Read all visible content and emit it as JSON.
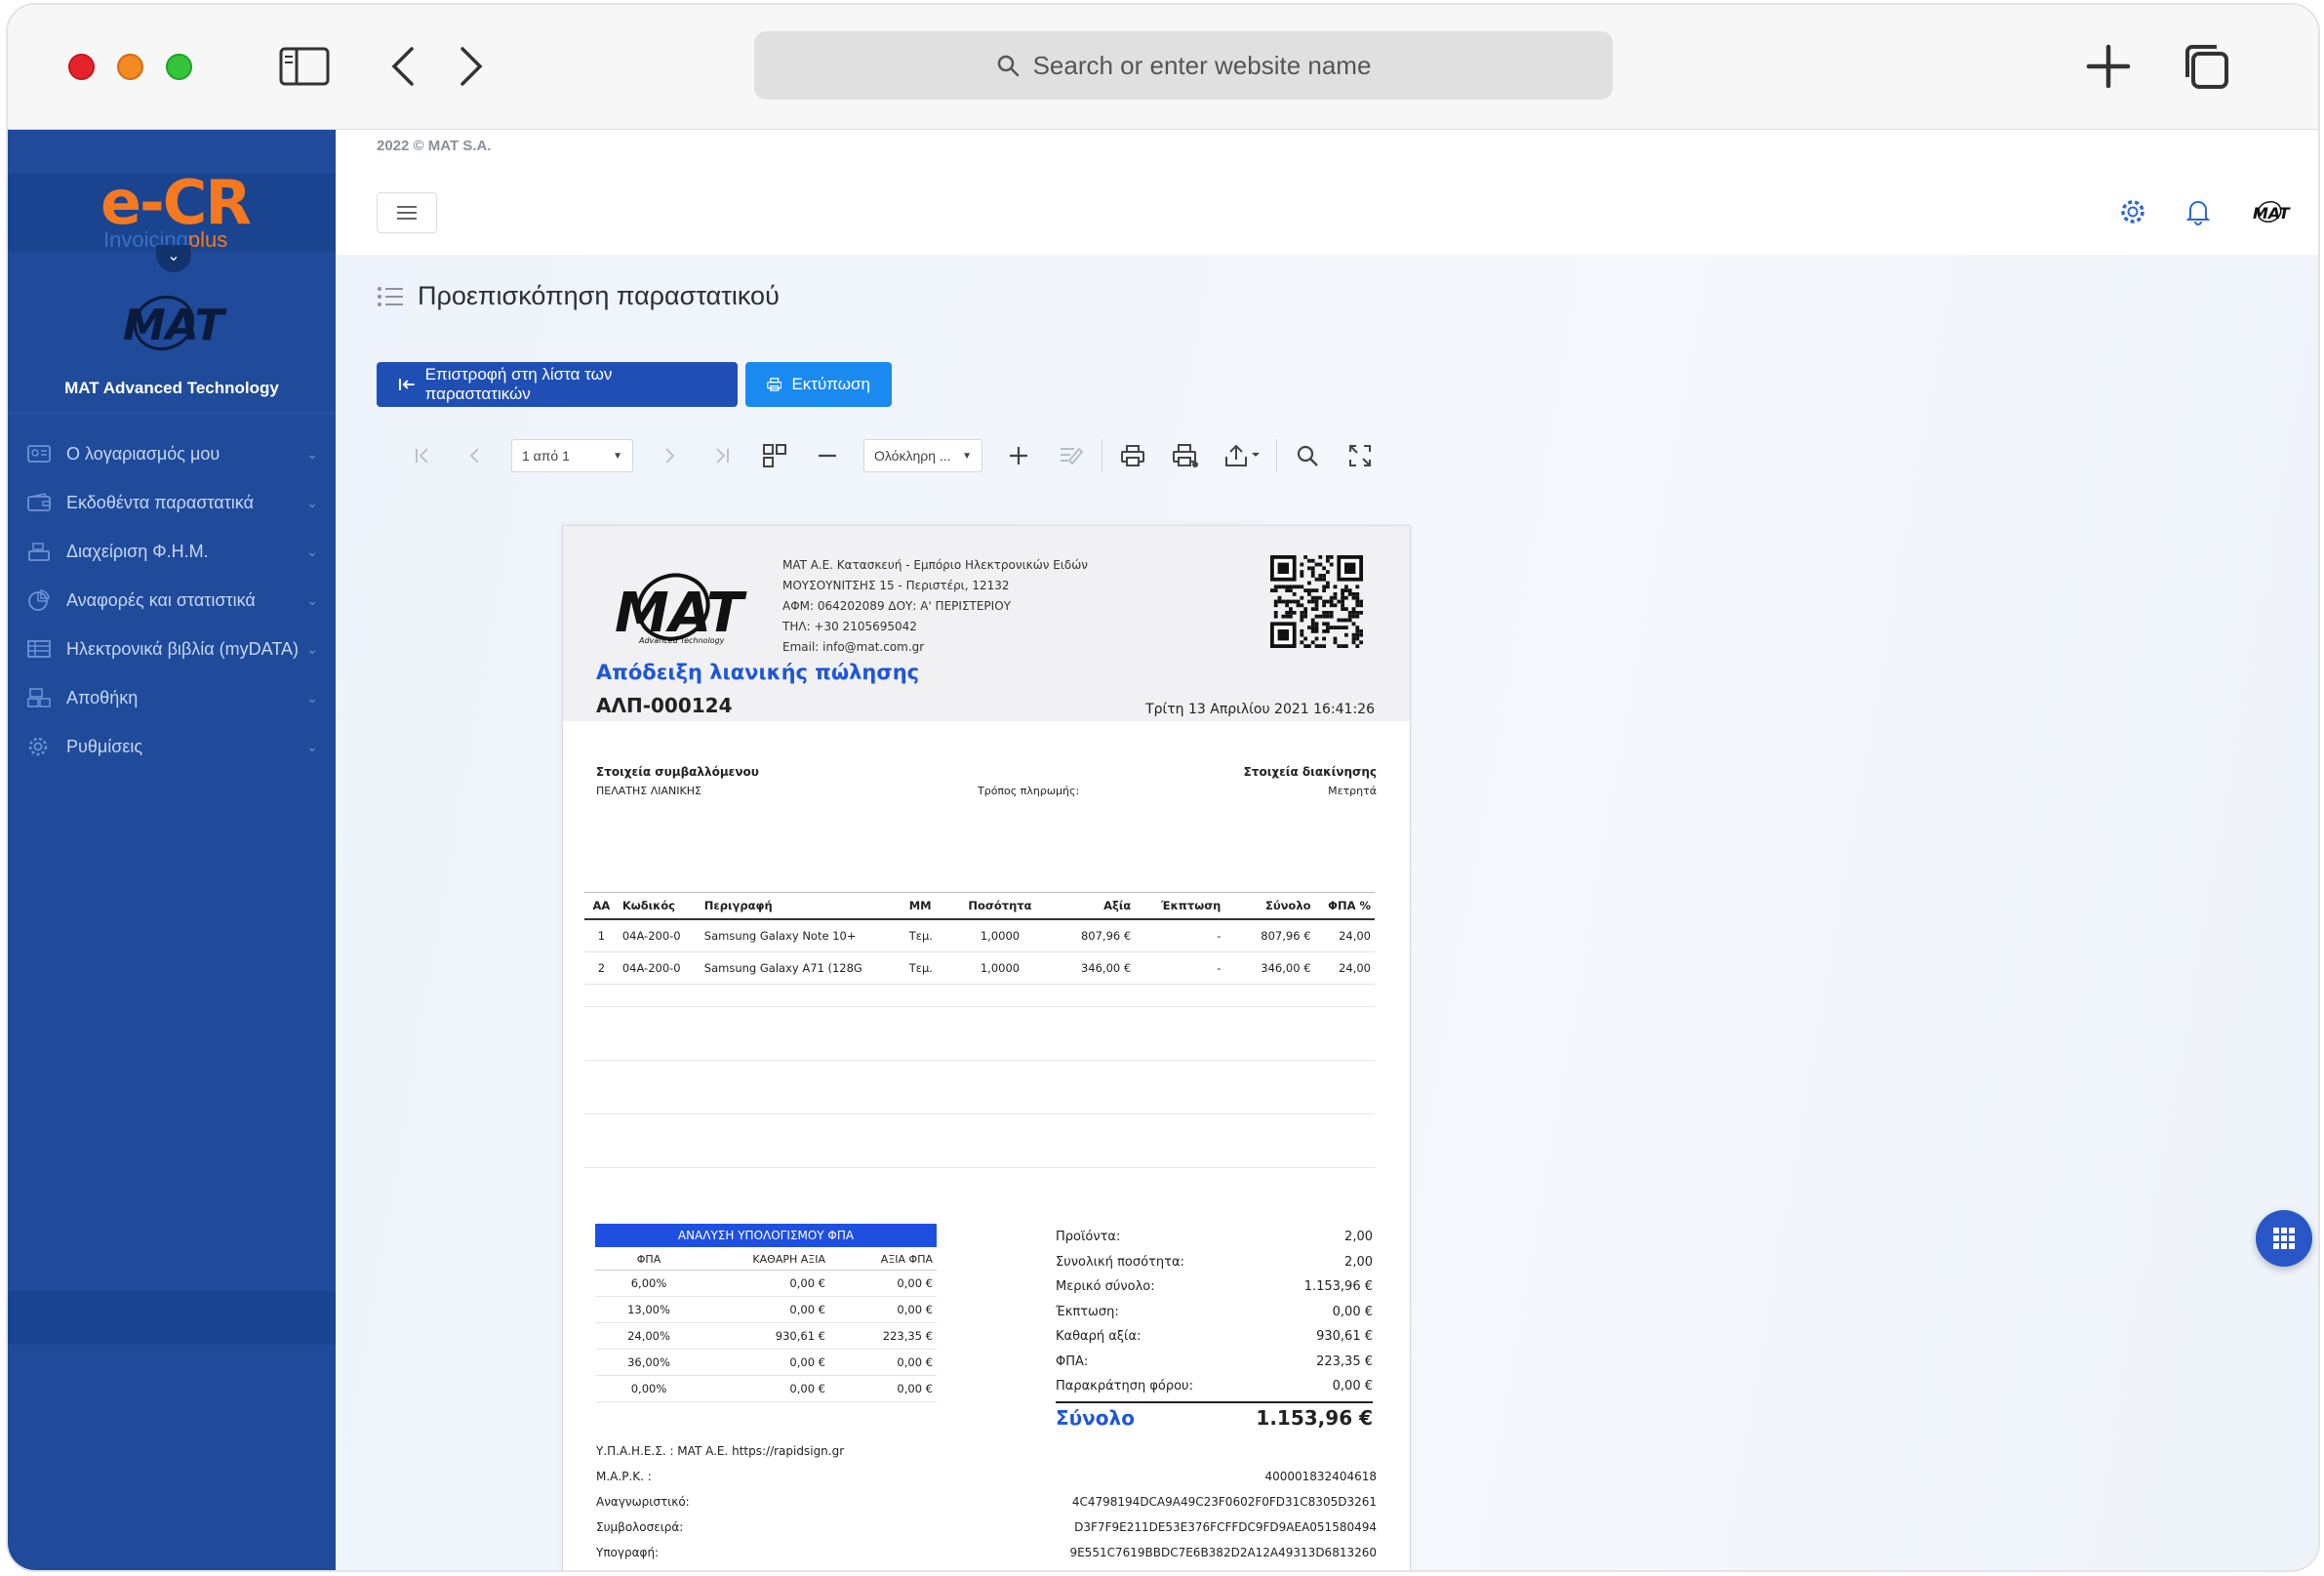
{
  "browser": {
    "url_placeholder": "Search or enter website name"
  },
  "sidebar": {
    "brand_main": "e-CR",
    "brand_sub_a": "Invoicing",
    "brand_sub_b": "plus",
    "org_name": "MAT Advanced Technology",
    "items": [
      {
        "label": "Ο λογαριασμός μου",
        "icon": "user-card-icon"
      },
      {
        "label": "Εκδοθέντα παραστατικά",
        "icon": "wallet-icon"
      },
      {
        "label": "Διαχείριση Φ.Η.Μ.",
        "icon": "cash-register-icon"
      },
      {
        "label": "Αναφορές και στατιστικά",
        "icon": "pie-chart-icon"
      },
      {
        "label": "Ηλεκτρονικά βιβλία (myDATA)",
        "icon": "table-icon"
      },
      {
        "label": "Αποθήκη",
        "icon": "warehouse-icon"
      },
      {
        "label": "Ρυθμίσεις",
        "icon": "gear-icon"
      }
    ]
  },
  "header": {
    "copyright": "2022 © MAT S.A.",
    "page_title": "Προεπισκόπηση παραστατικού",
    "back_button": "Επιστροφή στη λίστα των παραστατικών",
    "print_button": "Εκτύπωση"
  },
  "viewer": {
    "page_indicator": "1 από 1",
    "zoom_mode": "Ολόκληρη ..."
  },
  "document": {
    "logo_text": "MAT",
    "logo_tagline": "Advanced Technology",
    "issuer_lines": [
      "MAT A.E. Κατασκευή - Εμπόριο Ηλεκτρονικών Ειδών",
      "ΜΟΥΣΟΥΝΙΤΣΗΣ 15 - Περιστέρι, 12132",
      "ΑΦΜ: 064202089 ΔΟΥ: Α' ΠΕΡΙΣΤΕΡΙΟΥ",
      "ΤΗΛ: +30 2105695042",
      "Email: info@mat.com.gr"
    ],
    "title": "Απόδειξη λιανικής πώλησης",
    "number": "ΑΛΠ-000124",
    "date": "Τρίτη 13 Απριλίου 2021 16:41:26",
    "counterparty_label": "Στοιχεία συμβαλλόμενου",
    "counterparty_value": "ΠΕΛΑΤΗΣ ΛΙΑΝΙΚΗΣ",
    "payment_label": "Τρόπος πληρωμής:",
    "shipping_label": "Στοιχεία διακίνησης",
    "shipping_value": "Μετρητά",
    "columns": [
      "ΑΑ",
      "Κωδικός",
      "Περιγραφή",
      "ΜΜ",
      "Ποσότητα",
      "Αξία",
      "Έκπτωση",
      "Σύνολο",
      "ΦΠΑ %"
    ],
    "items": [
      {
        "aa": "1",
        "code": "04A-200-0",
        "desc": "Samsung Galaxy Note 10+",
        "unit": "Τεμ.",
        "qty": "1,0000",
        "value": "807,96 €",
        "discount": "-",
        "total": "807,96 €",
        "vat": "24,00"
      },
      {
        "aa": "2",
        "code": "04A-200-0",
        "desc": "Samsung Galaxy A71 (128G",
        "unit": "Τεμ.",
        "qty": "1,0000",
        "value": "346,00 €",
        "discount": "-",
        "total": "346,00 €",
        "vat": "24,00"
      }
    ],
    "vat_analysis_title": "ΑΝΑΛΥΣΗ ΥΠΟΛΟΓΙΣΜΟΥ ΦΠΑ",
    "vat_columns": [
      "ΦΠΑ",
      "ΚΑΘΑΡΗ ΑΞΙΑ",
      "ΑΞΙΑ ΦΠΑ"
    ],
    "vat_rows": [
      {
        "rate": "6,00%",
        "net": "0,00 €",
        "vat": "0,00 €"
      },
      {
        "rate": "13,00%",
        "net": "0,00 €",
        "vat": "0,00 €"
      },
      {
        "rate": "24,00%",
        "net": "930,61 €",
        "vat": "223,35 €"
      },
      {
        "rate": "36,00%",
        "net": "0,00 €",
        "vat": "0,00 €"
      },
      {
        "rate": "0,00%",
        "net": "0,00 €",
        "vat": "0,00 €"
      }
    ],
    "totals": [
      {
        "label": "Προϊόντα:",
        "value": "2,00"
      },
      {
        "label": "Συνολική ποσότητα:",
        "value": "2,00"
      },
      {
        "label": "Μερικό σύνολο:",
        "value": "1.153,96 €"
      },
      {
        "label": "Έκπτωση:",
        "value": "0,00 €"
      },
      {
        "label": "Καθαρή αξία:",
        "value": "930,61 €"
      },
      {
        "label": "ΦΠΑ:",
        "value": "223,35 €"
      },
      {
        "label": "Παρακράτηση φόρου:",
        "value": "0,00 €"
      }
    ],
    "grand_total_label": "Σύνολο",
    "grand_total_value": "1.153,96 €",
    "provider_line": "Υ.Π.Α.Η.Ε.Σ. : MAT A.E. https://rapidsign.gr",
    "signature_rows": [
      {
        "label": "Μ.Α.Ρ.Κ. :",
        "value": "400001832404618"
      },
      {
        "label": "Αναγνωριστικό:",
        "value": "4C4798194DCA9A49C23F0602F0FD31C8305D3261"
      },
      {
        "label": "Συμβολοσειρά:",
        "value": "D3F7F9E211DE53E376FCFFDC9FD9AEA051580494"
      },
      {
        "label": "Υπογραφή:",
        "value": "9E551C7619BBDC7E6B382D2A12A49313D6813260"
      }
    ]
  }
}
